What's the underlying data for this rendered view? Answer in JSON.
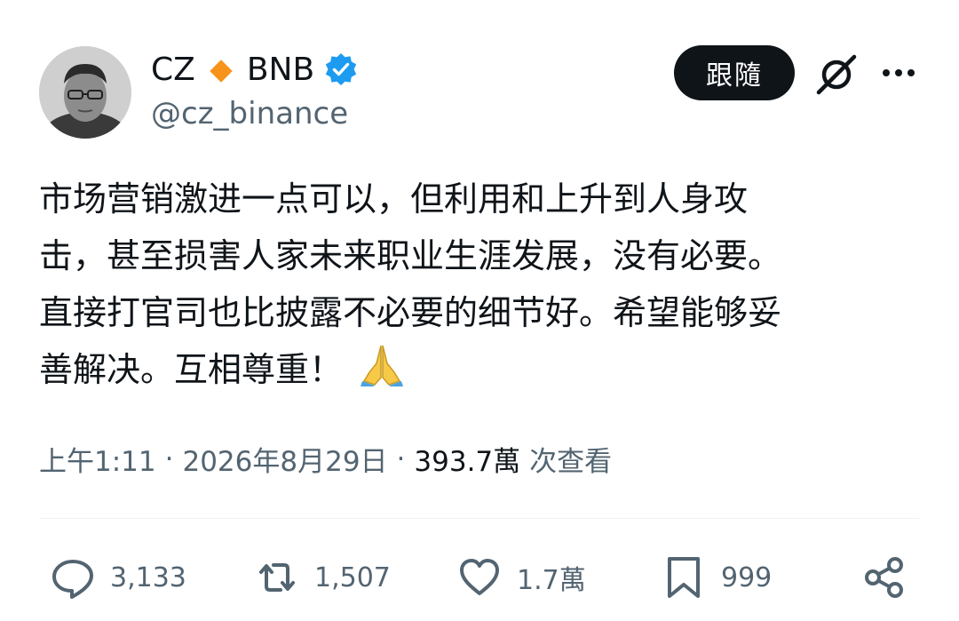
{
  "author": {
    "name": "CZ",
    "name_suffix": "BNB",
    "handle": "@cz_binance",
    "avatar_icon": "avatar",
    "diamond_color": "#f7931a",
    "verified_color": "#1d9bf0"
  },
  "header": {
    "follow_label": "跟隨",
    "grok_icon": "grok-icon",
    "more_icon": "more-icon"
  },
  "tweet": {
    "lines": [
      "市场营销激进一点可以，但利用和上升到人身攻",
      "击，甚至损害人家未来职业生涯发展，没有必要。",
      "直接打官司也比披露不必要的细节好。希望能够妥",
      "善解决。互相尊重！"
    ],
    "emoji": "🙏"
  },
  "meta": {
    "time": "上午1:11",
    "date": "2026年8月29日",
    "views": "393.7萬",
    "views_label": "次查看"
  },
  "actions": {
    "replies": "3,133",
    "reposts": "1,507",
    "likes": "1.7萬",
    "bookmarks": "999"
  },
  "colors": {
    "text": "#0f1419",
    "secondary": "#536471",
    "follow_bg": "#0f1419",
    "divider": "#eff3f4"
  }
}
